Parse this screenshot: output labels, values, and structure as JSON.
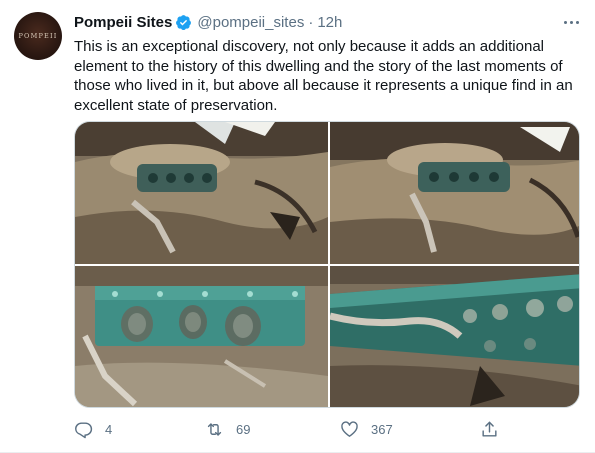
{
  "tweet": {
    "avatar_text": "POMPEII",
    "author_name": "Pompeii Sites",
    "handle": "@pompeii_sites",
    "separator": "·",
    "time": "12h",
    "text": "This is an exceptional discovery, not only because it adds an additional element to the history of this dwelling and the story of the last moments of those who lived in it, but above all because it represents a unique find in an excellent state of preservation.",
    "photos": [
      "chariot-overview-left",
      "chariot-overview-right",
      "bronze-decoration-front",
      "bronze-decoration-side"
    ],
    "actions": {
      "replies": "4",
      "retweets": "69",
      "likes": "367"
    },
    "colors": {
      "verified": "#1da1f2",
      "secondary_text": "#5b7083",
      "bronze_patina": "#3f8f86",
      "ash": "#8a7d6b"
    }
  }
}
